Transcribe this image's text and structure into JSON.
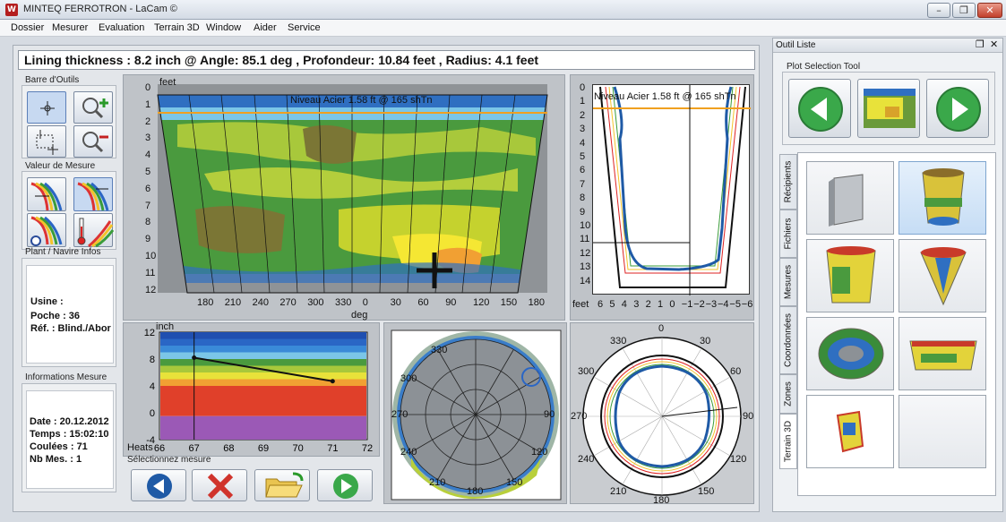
{
  "window": {
    "logo_text": "W",
    "title": "MINTEQ FERROTRON - LaCam ©",
    "minimize": "–",
    "restore": "❐",
    "close": "✕"
  },
  "menu": [
    "Dossier",
    "Mesurer",
    "Evaluation",
    "Terrain 3D",
    "Window",
    "Aider",
    "Service"
  ],
  "readout": "Lining thickness : 8.2 inch @ Angle: 85.1 deg , Profondeur: 10.84 feet , Radius: 4.1 feet",
  "toolbar": {
    "title": "Barre d'Outils",
    "buttons": [
      {
        "name": "crosshair-tool-button",
        "icon": "crosshair-icon"
      },
      {
        "name": "zoom-in-button",
        "icon": "zoom-in-icon"
      },
      {
        "name": "zoom-window-button",
        "icon": "zoom-window-icon"
      },
      {
        "name": "zoom-out-button",
        "icon": "zoom-out-icon"
      }
    ]
  },
  "measure_value": {
    "title": "Valeur de Mesure"
  },
  "plant_info": {
    "title": "Plant / Navire Infos",
    "usine": "Usine :",
    "poche": "Poche : 36",
    "ref": "Réf. : Blind./Abor"
  },
  "measure_info": {
    "title": "Informations Mesure",
    "date": "Date : 20.12.2012",
    "time": "Temps : 15:02:10",
    "heats": "Coulées : 71",
    "nb": "Nb Mes. : 1"
  },
  "select_measure": {
    "title": "Sélectionnez mesure"
  },
  "unrolled_plot": {
    "y_unit": "feet",
    "x_unit": "deg",
    "annotation": "Niveau Acier 1.58 ft @ 165 shTn",
    "y_ticks": [
      "0",
      "1",
      "2",
      "3",
      "4",
      "5",
      "6",
      "7",
      "8",
      "9",
      "10",
      "11",
      "12"
    ],
    "x_ticks": [
      "180",
      "210",
      "240",
      "270",
      "300",
      "330",
      "0",
      "30",
      "60",
      "90",
      "120",
      "150",
      "180"
    ]
  },
  "profile_plot": {
    "annotation": "Niveau Acier 1.58 ft @ 165 shTn",
    "y_ticks": [
      "0",
      "1",
      "2",
      "3",
      "4",
      "5",
      "6",
      "7",
      "8",
      "9",
      "10",
      "11",
      "12",
      "13",
      "14"
    ],
    "x_unit": "feet",
    "x_ticks": [
      "6",
      "5",
      "4",
      "3",
      "2",
      "1",
      "0",
      "−1",
      "−2",
      "−3",
      "−4",
      "−5",
      "−6"
    ]
  },
  "chart_data": {
    "type": "line",
    "ylabel": "inch",
    "xlabel": "Heats",
    "x": [
      67,
      71
    ],
    "series": [
      {
        "values": [
          8.2,
          4.7
        ]
      }
    ],
    "xlim": [
      66,
      72
    ],
    "ylim": [
      -4,
      12
    ],
    "x_ticks": [
      "66",
      "67",
      "68",
      "69",
      "70",
      "71",
      "72"
    ],
    "y_ticks": [
      "12",
      "8",
      "4",
      "0",
      "-4"
    ]
  },
  "polar_bottom": {
    "labels": [
      "330",
      "300",
      "270",
      "240",
      "210",
      "180",
      "150",
      "120",
      "90"
    ]
  },
  "polar_section": {
    "labels": [
      "0",
      "30",
      "60",
      "90",
      "120",
      "150",
      "180",
      "210",
      "240",
      "270",
      "300",
      "330"
    ]
  },
  "right_panel": {
    "title": "Outil Liste",
    "plot_selection_title": "Plot Selection Tool",
    "tabs": [
      "Récipients",
      "Fichiers",
      "Mesures",
      "Coordonnées",
      "Zones",
      "Terrain 3D"
    ]
  },
  "colors": {
    "green_btn": "#3aa84a",
    "blue_btn": "#1f5aa6",
    "red_cross": "#d0342c",
    "steel_level": "#f0a020"
  }
}
